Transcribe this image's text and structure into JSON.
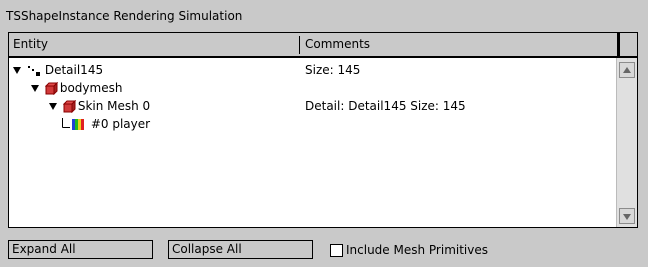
{
  "window": {
    "title": "TSShapeInstance Rendering Simulation"
  },
  "table": {
    "columns": [
      "Entity",
      "Comments"
    ],
    "rows": [
      {
        "label": "Detail145",
        "comment": "Size: 145",
        "icon": "detail-dots-icon",
        "expanded": true
      },
      {
        "label": "bodymesh",
        "comment": "",
        "icon": "red-cube-icon",
        "expanded": true
      },
      {
        "label": "Skin Mesh 0",
        "comment": "Detail: Detail145 Size: 145",
        "icon": "red-cube-icon",
        "expanded": true
      },
      {
        "label": "#0 player",
        "comment": "",
        "icon": "color-bars-icon",
        "expanded": false
      }
    ]
  },
  "toolbar": {
    "expand_all": "Expand All",
    "collapse_all": "Collapse All",
    "include_mesh_primitives": "Include Mesh Primitives",
    "include_mesh_primitives_checked": false
  }
}
